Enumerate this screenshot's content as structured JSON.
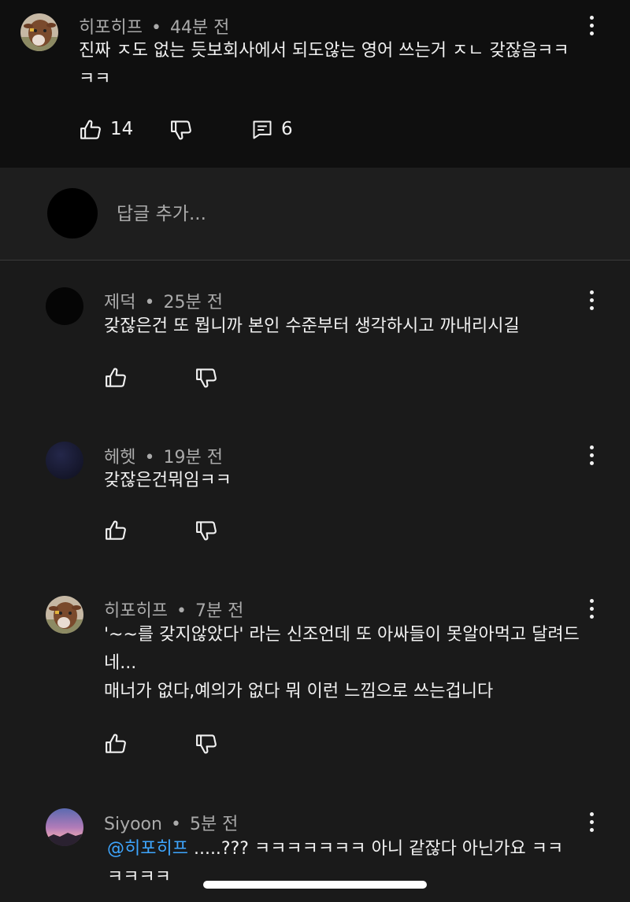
{
  "top_comment": {
    "author": "히포히프",
    "time": "44분 전",
    "text": "진짜 ㅈ도 없는 듯보회사에서 되도않는 영어 쓰는거 ㅈㄴ 갖잖음ㅋㅋ\nㅋㅋ",
    "likes": "14",
    "replies": "6",
    "like_icon": "thumb-up-icon",
    "dislike_icon": "thumb-down-icon",
    "reply_icon": "comment-icon"
  },
  "reply_input": {
    "placeholder": "답글 추가..."
  },
  "replies": [
    {
      "author": "제덕",
      "time": "25분 전",
      "text": "갖잖은건 또 뭡니까 본인 수준부터 생각하시고 까내리시길"
    },
    {
      "author": "헤헷",
      "time": "19분 전",
      "text": "갖잖은건뭐임ㅋㅋ"
    },
    {
      "author": "히포히프",
      "time": "7분 전",
      "text": "'~~를 갖지않았다' 라는 신조언데 또 아싸들이 못알아먹고 달려드\n네...\n매너가 없다,예의가 없다 뭐 이런 느낌으로 쓰는겁니다"
    },
    {
      "author": "Siyoon",
      "time": "5분 전",
      "mention": "@히포히프",
      "text": " .....??? ㅋㅋㅋㅋㅋㅋㅋ 아니 같잖다 아닌가요 ㅋㅋ\nㅋㅋㅋㅋ"
    }
  ],
  "colors": {
    "background": "#1a1a1a",
    "top_background": "#0f0f0f",
    "mention": "#3ea6ff",
    "secondary_text": "#aaaaaa"
  },
  "separator": "•"
}
